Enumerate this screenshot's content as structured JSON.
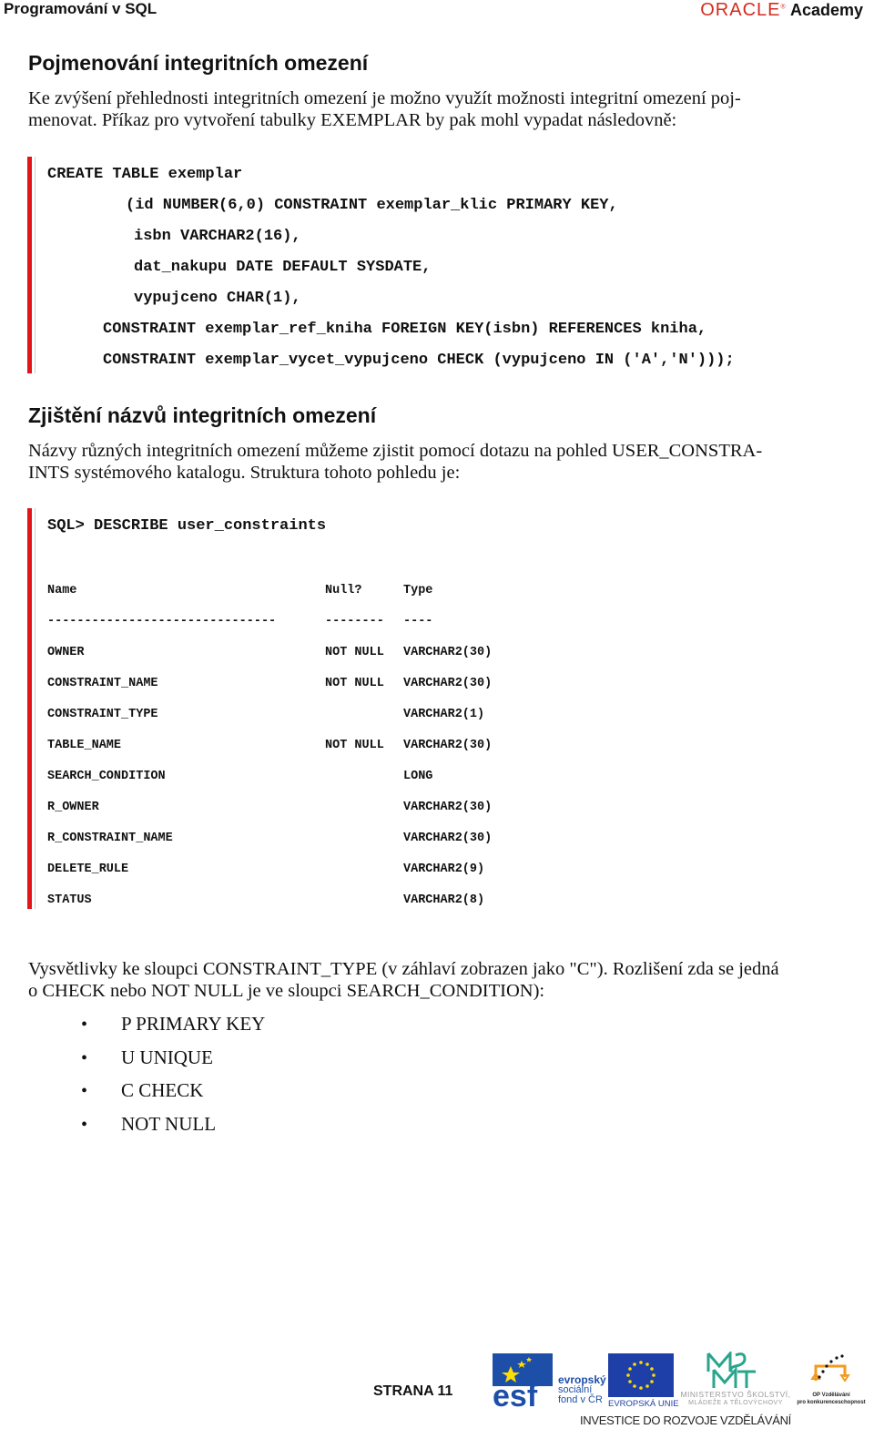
{
  "header": {
    "course_title": "Programování v SQL",
    "brand_oracle": "ORACLE",
    "brand_academy": "Academy"
  },
  "section1": {
    "heading": "Pojmenování integritních omezení",
    "paragraph_line1": "Ke zvýšení přehlednosti integritních omezení je možno využít možnosti integritní omezení poj-",
    "paragraph_line2": "menovat. Příkaz pro vytvoření tabulky EXEMPLAR by pak mohl vypadat následovně:",
    "code_lines": [
      "CREATE TABLE exemplar",
      "(id NUMBER(6,0) CONSTRAINT exemplar_klic PRIMARY KEY,",
      "isbn VARCHAR2(16),",
      "dat_nakupu DATE DEFAULT SYSDATE,",
      "vypujceno CHAR(1),",
      "CONSTRAINT exemplar_ref_kniha FOREIGN KEY(isbn) REFERENCES kniha,",
      "CONSTRAINT exemplar_vycet_vypujceno CHECK (vypujceno IN ('A','N')));"
    ]
  },
  "section2": {
    "heading": "Zjištění názvů integritních omezení",
    "paragraph_line1": "Názvy různých integritních omezení můžeme zjistit pomocí dotazu na pohled USER_CONSTRA-",
    "paragraph_line2": "INTS systémového katalogu. Struktura tohoto pohledu je:",
    "command": "SQL> DESCRIBE user_constraints",
    "describe": {
      "columns": [
        "Name",
        "Null?",
        "Type"
      ],
      "separator": [
        "-------------------------------",
        "--------",
        "----"
      ],
      "rows": [
        {
          "name": "OWNER",
          "null": "NOT NULL",
          "type": "VARCHAR2(30)"
        },
        {
          "name": "CONSTRAINT_NAME",
          "null": "NOT NULL",
          "type": "VARCHAR2(30)"
        },
        {
          "name": "CONSTRAINT_TYPE",
          "null": "",
          "type": "VARCHAR2(1)"
        },
        {
          "name": "TABLE_NAME",
          "null": "NOT NULL",
          "type": "VARCHAR2(30)"
        },
        {
          "name": "SEARCH_CONDITION",
          "null": "",
          "type": "LONG"
        },
        {
          "name": "R_OWNER",
          "null": "",
          "type": "VARCHAR2(30)"
        },
        {
          "name": "R_CONSTRAINT_NAME",
          "null": "",
          "type": "VARCHAR2(30)"
        },
        {
          "name": "DELETE_RULE",
          "null": "",
          "type": "VARCHAR2(9)"
        },
        {
          "name": "STATUS",
          "null": "",
          "type": "VARCHAR2(8)"
        }
      ]
    }
  },
  "section3": {
    "paragraph_line1": "Vysvětlivky ke sloupci CONSTRAINT_TYPE (v záhlaví zobrazen jako \"C\"). Rozlišení zda se jedná",
    "paragraph_line2": "o CHECK nebo NOT NULL je ve sloupci SEARCH_CONDITION):",
    "bullet_symbol": "•",
    "bullets": [
      "P PRIMARY KEY",
      "U UNIQUE",
      "C CHECK",
      "NOT NULL"
    ]
  },
  "footer": {
    "page_label": "STRANA 11",
    "esf_text": [
      "evropský",
      "sociální",
      "fond v ČR"
    ],
    "eu_text": "EVROPSKÁ UNIE",
    "msmt_text": [
      "MINISTERSTVO ŠKOLSTVÍ,",
      "MLÁDEŽE A TĚLOVÝCHOVY"
    ],
    "op_text": [
      "OP Vzdělávání",
      "pro konkurenceschopnost"
    ],
    "investment_slogan": "INVESTICE DO ROZVOJE VZDĚLÁVÁNÍ",
    "colors": {
      "esf_blue": "#1d4fa8",
      "eu_blue": "#1f3fa8",
      "eu_star": "#ffdd00",
      "msmt_teal": "#2aa58c",
      "op_orange": "#f39a1e"
    }
  }
}
